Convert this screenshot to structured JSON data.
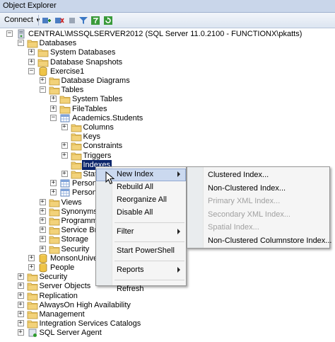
{
  "window": {
    "title": "Object Explorer"
  },
  "toolbar": {
    "connect_label": "Connect"
  },
  "tree": [
    {
      "label": "CENTRAL\\MSSQLSERVER2012 (SQL Server 11.0.2100 - FUNCTIONX\\pkatts)",
      "icon": "server",
      "level": 0,
      "exp": "-"
    },
    {
      "label": "Databases",
      "icon": "folder",
      "level": 1,
      "exp": "-"
    },
    {
      "label": "System Databases",
      "icon": "folder",
      "level": 2,
      "exp": "+"
    },
    {
      "label": "Database Snapshots",
      "icon": "folder",
      "level": 2,
      "exp": "+"
    },
    {
      "label": "Exercise1",
      "icon": "database",
      "level": 2,
      "exp": "-"
    },
    {
      "label": "Database Diagrams",
      "icon": "folder",
      "level": 3,
      "exp": "+"
    },
    {
      "label": "Tables",
      "icon": "folder",
      "level": 3,
      "exp": "-"
    },
    {
      "label": "System Tables",
      "icon": "folder",
      "level": 4,
      "exp": "+"
    },
    {
      "label": "FileTables",
      "icon": "folder",
      "level": 4,
      "exp": "+"
    },
    {
      "label": "Academics.Students",
      "icon": "table",
      "level": 4,
      "exp": "-"
    },
    {
      "label": "Columns",
      "icon": "folder",
      "level": 5,
      "exp": "+"
    },
    {
      "label": "Keys",
      "icon": "folder",
      "level": 5,
      "exp": ""
    },
    {
      "label": "Constraints",
      "icon": "folder",
      "level": 5,
      "exp": "+"
    },
    {
      "label": "Triggers",
      "icon": "folder",
      "level": 5,
      "exp": "+"
    },
    {
      "label": "Indexes",
      "icon": "folder",
      "level": 5,
      "exp": "",
      "selected": true
    },
    {
      "label": "Stat",
      "icon": "folder",
      "level": 5,
      "exp": "+"
    },
    {
      "label": "Personn",
      "icon": "table",
      "level": 4,
      "exp": "+"
    },
    {
      "label": "Personn",
      "icon": "table",
      "level": 4,
      "exp": "+"
    },
    {
      "label": "Views",
      "icon": "folder",
      "level": 3,
      "exp": "+"
    },
    {
      "label": "Synonyms",
      "icon": "folder",
      "level": 3,
      "exp": "+"
    },
    {
      "label": "Programmab",
      "icon": "folder",
      "level": 3,
      "exp": "+"
    },
    {
      "label": "Service Brok",
      "icon": "folder",
      "level": 3,
      "exp": "+"
    },
    {
      "label": "Storage",
      "icon": "folder",
      "level": 3,
      "exp": "+"
    },
    {
      "label": "Security",
      "icon": "folder",
      "level": 3,
      "exp": "+"
    },
    {
      "label": "MonsonUniversit",
      "icon": "database",
      "level": 2,
      "exp": "+"
    },
    {
      "label": "People",
      "icon": "database",
      "level": 2,
      "exp": "+"
    },
    {
      "label": "Security",
      "icon": "folder",
      "level": 1,
      "exp": "+"
    },
    {
      "label": "Server Objects",
      "icon": "folder",
      "level": 1,
      "exp": "+"
    },
    {
      "label": "Replication",
      "icon": "folder",
      "level": 1,
      "exp": "+"
    },
    {
      "label": "AlwaysOn High Availability",
      "icon": "folder",
      "level": 1,
      "exp": "+"
    },
    {
      "label": "Management",
      "icon": "folder",
      "level": 1,
      "exp": "+"
    },
    {
      "label": "Integration Services Catalogs",
      "icon": "folder",
      "level": 1,
      "exp": "+"
    },
    {
      "label": "SQL Server Agent",
      "icon": "agent",
      "level": 1,
      "exp": "+"
    }
  ],
  "context_menu": {
    "items": [
      {
        "label": "New Index",
        "submenu": true,
        "hot": true
      },
      {
        "label": "Rebuild All"
      },
      {
        "label": "Reorganize All"
      },
      {
        "label": "Disable All"
      },
      {
        "separator": true
      },
      {
        "label": "Filter",
        "submenu": true
      },
      {
        "separator": true
      },
      {
        "label": "Start PowerShell"
      },
      {
        "separator": true
      },
      {
        "label": "Reports",
        "submenu": true
      },
      {
        "separator": true
      },
      {
        "label": "Refresh"
      }
    ]
  },
  "submenu": {
    "items": [
      {
        "label": "Clustered Index...",
        "enabled": true
      },
      {
        "label": "Non-Clustered Index...",
        "enabled": true
      },
      {
        "label": "Primary XML Index...",
        "enabled": false
      },
      {
        "label": "Secondary XML Index...",
        "enabled": false
      },
      {
        "label": "Spatial Index...",
        "enabled": false
      },
      {
        "label": "Non-Clustered Columnstore Index...",
        "enabled": true
      }
    ]
  }
}
